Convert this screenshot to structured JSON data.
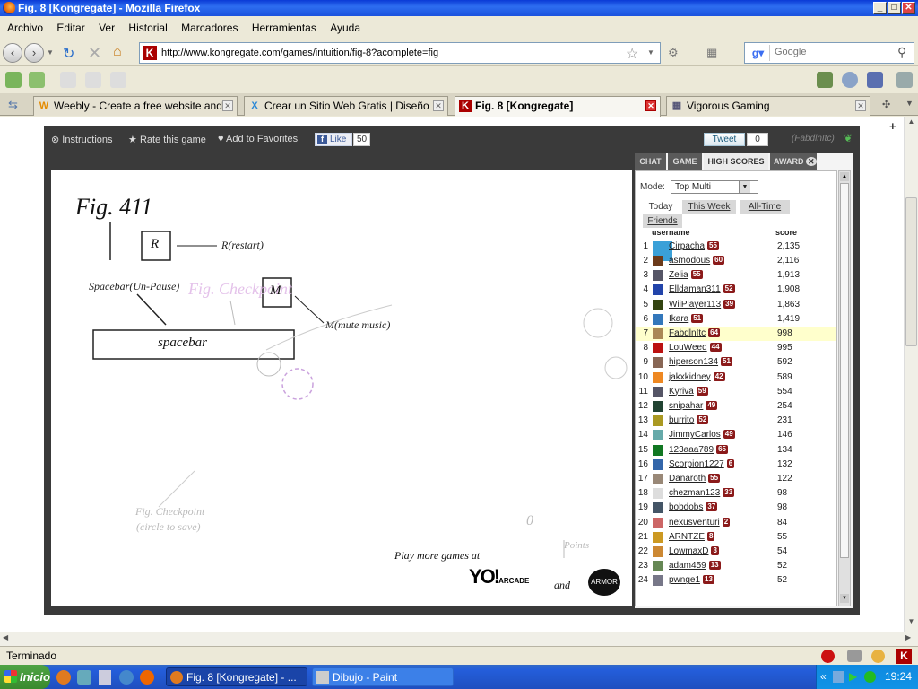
{
  "window": {
    "title": "Fig. 8 [Kongregate] - Mozilla Firefox",
    "min": "_",
    "max": "□",
    "close": "✕"
  },
  "menu": [
    "Archivo",
    "Editar",
    "Ver",
    "Historial",
    "Marcadores",
    "Herramientas",
    "Ayuda"
  ],
  "nav": {
    "url": "http://www.kongregate.com/games/intuition/fig-8?acomplete=fig",
    "search_placeholder": "Google"
  },
  "tabs": [
    {
      "label": "Weebly - Create a free website and...",
      "icon": "W"
    },
    {
      "label": "Crear un Sitio Web Gratis | Diseño ...",
      "icon": "X"
    },
    {
      "label": "Fig. 8 [Kongregate]",
      "icon": "K"
    },
    {
      "label": "Vigorous Gaming",
      "icon": "▦"
    }
  ],
  "game_bar": {
    "instructions": "Instructions",
    "rate": "Rate this game",
    "favorites": "Add to Favorites",
    "like": "Like",
    "like_count": "50",
    "tweet": "Tweet",
    "tweet_count": "0",
    "user": "(FabdlnItc)"
  },
  "game": {
    "title": "Fig. 411",
    "r_key": "R",
    "r_label": "R(restart)",
    "spacebar_label": "Spacebar(Un-Pause)",
    "checkpoint_top": "Fig. Checkpoint",
    "m_key": "M",
    "m_label": "M(mute music)",
    "spacebar_key": "spacebar",
    "checkpoint_bottom_1": "Fig. Checkpoint",
    "checkpoint_bottom_2": "(circle to save)",
    "zero": "0",
    "points": "Points",
    "play_more": "Play more games at",
    "and": "and",
    "logo1": "YO!ARCADE",
    "logo2": "ARMOR"
  },
  "panel": {
    "tabs": [
      "CHAT",
      "GAME",
      "HIGH SCORES",
      "AWARD"
    ],
    "mode_label": "Mode:",
    "mode_value": "Top Multi",
    "subtabs": [
      "Today",
      "This Week",
      "All-Time",
      "Friends"
    ],
    "col_user": "username",
    "col_score": "score",
    "rows": [
      {
        "rank": "1",
        "user": "Cirpacha",
        "level": "55",
        "score": "2,135",
        "color": "#3aa0d8"
      },
      {
        "rank": "2",
        "user": "asmodous",
        "level": "60",
        "score": "2,116",
        "color": "#6b3a1a"
      },
      {
        "rank": "3",
        "user": "Zelia",
        "level": "55",
        "score": "1,913",
        "color": "#556"
      },
      {
        "rank": "4",
        "user": "Elldaman311",
        "level": "52",
        "score": "1,908",
        "color": "#2244aa"
      },
      {
        "rank": "5",
        "user": "WiiPlayer113",
        "level": "39",
        "score": "1,863",
        "color": "#334411"
      },
      {
        "rank": "6",
        "user": "Ikara",
        "level": "51",
        "score": "1,419",
        "color": "#3377bb"
      },
      {
        "rank": "7",
        "user": "FabdlnItc",
        "level": "64",
        "score": "998",
        "color": "#aa8855"
      },
      {
        "rank": "8",
        "user": "LouWeed",
        "level": "44",
        "score": "995",
        "color": "#bb1111"
      },
      {
        "rank": "9",
        "user": "hiperson134",
        "level": "51",
        "score": "592",
        "color": "#886655"
      },
      {
        "rank": "10",
        "user": "jakxkidney",
        "level": "42",
        "score": "589",
        "color": "#ee8822"
      },
      {
        "rank": "11",
        "user": "Kyriva",
        "level": "59",
        "score": "554",
        "color": "#555566"
      },
      {
        "rank": "12",
        "user": "snipahar",
        "level": "49",
        "score": "254",
        "color": "#224433"
      },
      {
        "rank": "13",
        "user": "burrito",
        "level": "52",
        "score": "231",
        "color": "#aa9922"
      },
      {
        "rank": "14",
        "user": "JimmyCarlos",
        "level": "49",
        "score": "146",
        "color": "#66aaaa"
      },
      {
        "rank": "15",
        "user": "123aaa789",
        "level": "65",
        "score": "134",
        "color": "#117722"
      },
      {
        "rank": "16",
        "user": "Scorpion1227",
        "level": "6",
        "score": "132",
        "color": "#3366aa"
      },
      {
        "rank": "17",
        "user": "Danaroth",
        "level": "55",
        "score": "122",
        "color": "#998877"
      },
      {
        "rank": "18",
        "user": "chezman123",
        "level": "33",
        "score": "98",
        "color": "#dddddd"
      },
      {
        "rank": "19",
        "user": "bobdobs",
        "level": "37",
        "score": "98",
        "color": "#445566"
      },
      {
        "rank": "20",
        "user": "nexusventuri",
        "level": "2",
        "score": "84",
        "color": "#cc6666"
      },
      {
        "rank": "21",
        "user": "ARNTZE",
        "level": "8",
        "score": "55",
        "color": "#cc9922"
      },
      {
        "rank": "22",
        "user": "LowmaxD",
        "level": "3",
        "score": "54",
        "color": "#cc8833"
      },
      {
        "rank": "23",
        "user": "adam459",
        "level": "13",
        "score": "52",
        "color": "#668855"
      },
      {
        "rank": "24",
        "user": "pwnge1",
        "level": "13",
        "score": "52",
        "color": "#777788"
      }
    ]
  },
  "status": "Terminado",
  "taskbar": {
    "start": "Inicio",
    "task1": "Fig. 8 [Kongregate] - ...",
    "task2": "Dibujo - Paint",
    "clock": "19:24"
  }
}
